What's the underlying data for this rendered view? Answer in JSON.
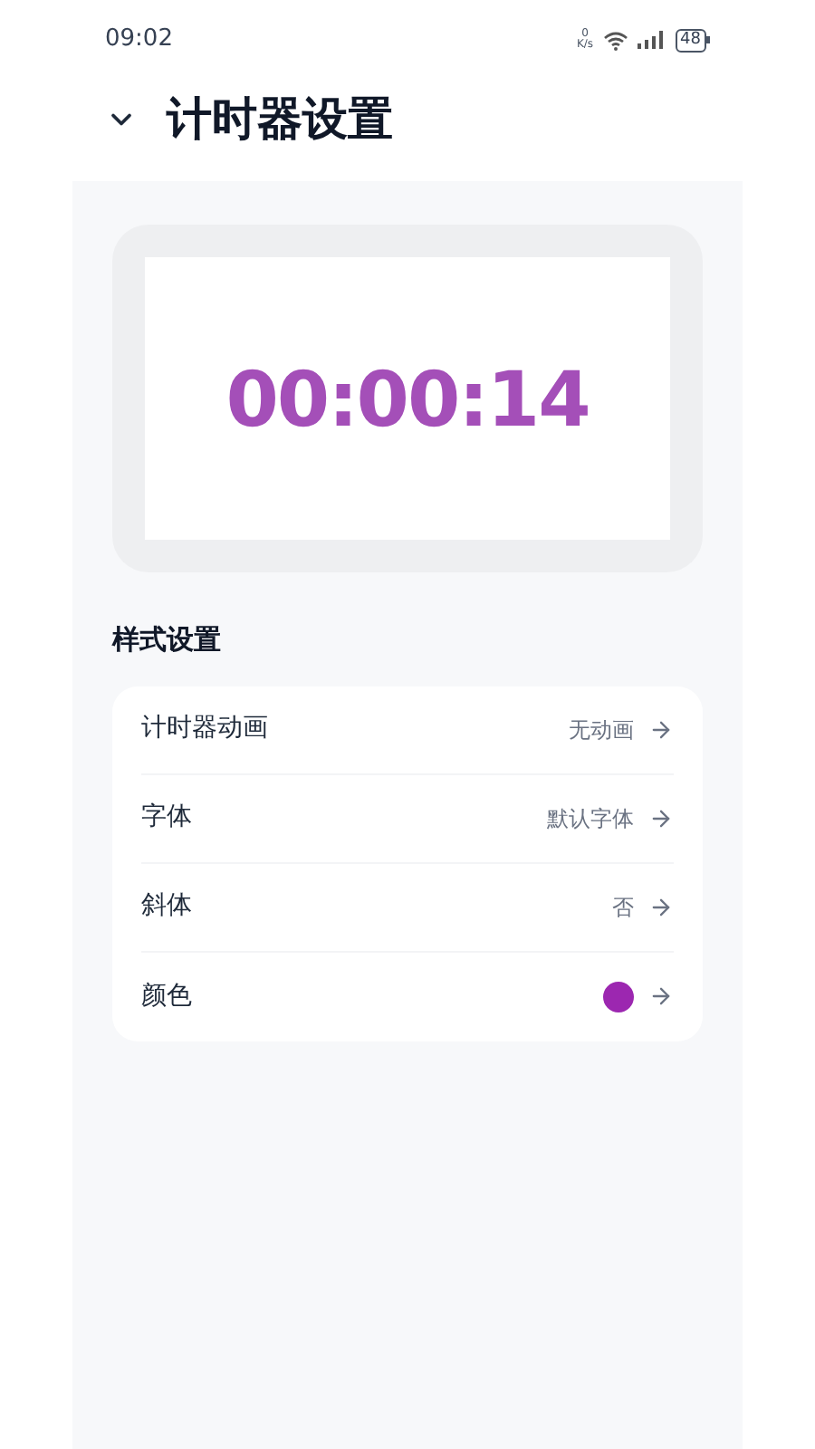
{
  "status_bar": {
    "time": "09:02",
    "speed_value": "0",
    "speed_unit": "K/s",
    "battery": "48"
  },
  "header": {
    "title": "计时器设置"
  },
  "preview": {
    "timer": "00:00:14"
  },
  "section_title": "样式设置",
  "settings": [
    {
      "kind": "text",
      "label": "计时器动画",
      "value": "无动画"
    },
    {
      "kind": "text",
      "label": "字体",
      "value": "默认字体"
    },
    {
      "kind": "text",
      "label": "斜体",
      "value": "否"
    },
    {
      "kind": "color",
      "label": "颜色",
      "color": "#9c27b0"
    }
  ]
}
